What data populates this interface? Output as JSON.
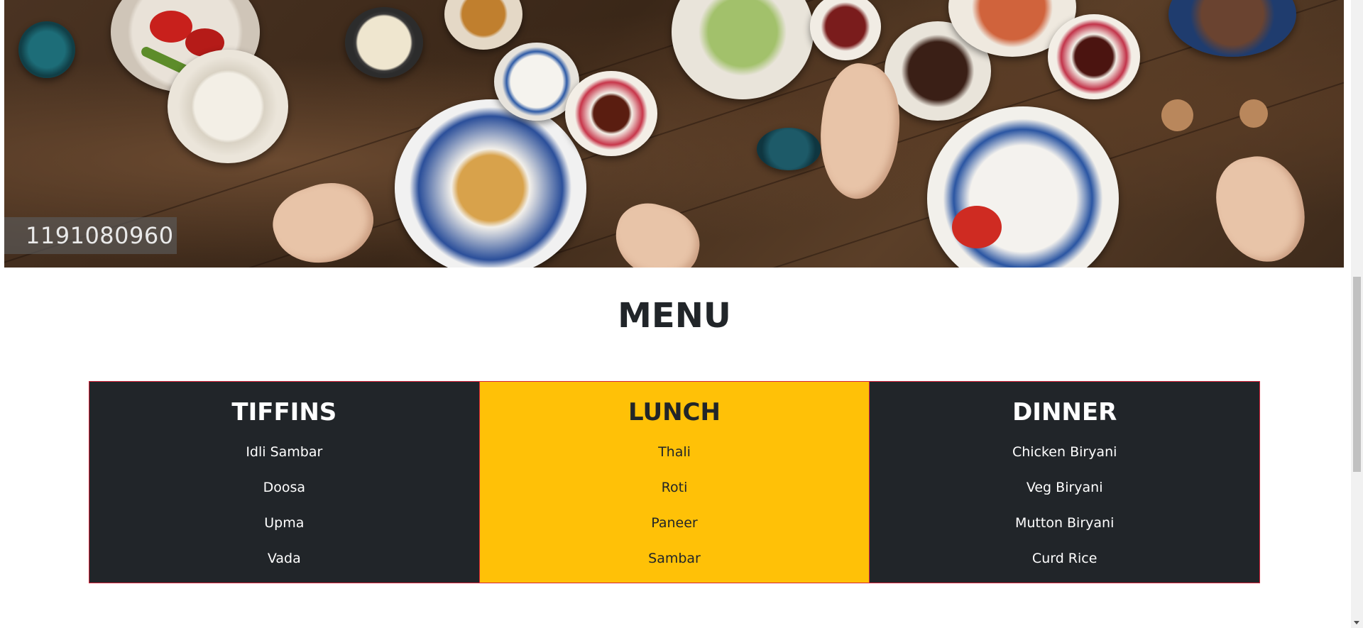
{
  "hero": {
    "image_name": "food-table-photo",
    "watermark": "1191080960"
  },
  "menu": {
    "title": "MENU",
    "columns": [
      {
        "heading": "TIFFINS",
        "items": [
          "Idli Sambar",
          "Doosa",
          "Upma",
          "Vada"
        ]
      },
      {
        "heading": "LUNCH",
        "items": [
          "Thali",
          "Roti",
          "Paneer",
          "Sambar"
        ]
      },
      {
        "heading": "DINNER",
        "items": [
          "Chicken Biryani",
          "Veg Biryani",
          "Mutton Biryani",
          "Curd Rice"
        ]
      }
    ]
  },
  "colors": {
    "dark": "#212529",
    "accent_yellow": "#ffc107",
    "border_red": "#d6233a",
    "text_light": "#ffffff"
  }
}
